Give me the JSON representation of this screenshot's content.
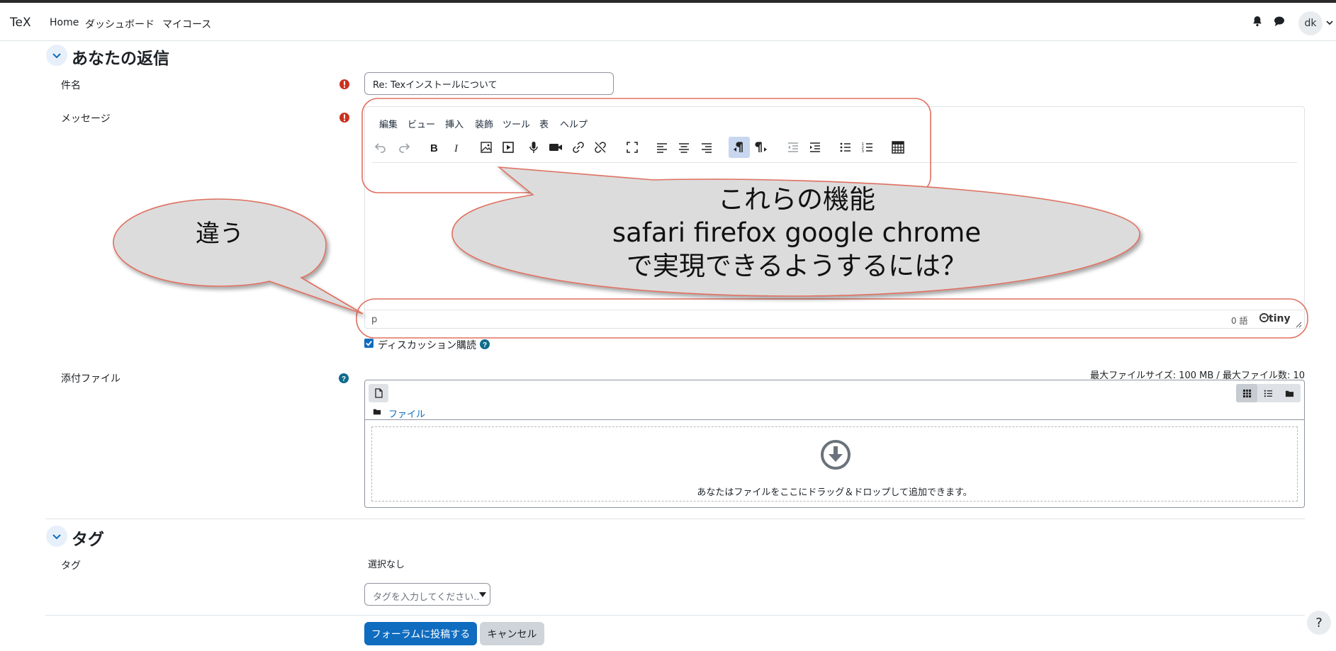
{
  "navbar": {
    "brand": "TeX",
    "links": [
      "Home",
      "ダッシュボード",
      "マイコース"
    ],
    "icons": [
      "bell-icon",
      "chat-icon"
    ],
    "avatar_initials": "dk"
  },
  "reply_section": {
    "title": "あなたの返信",
    "subject_label": "件名",
    "subject_value": "Re: Texインストールについて",
    "message_label": "メッセージ",
    "editor": {
      "menu": [
        "編集",
        "ビュー",
        "挿入",
        "装飾",
        "ツール",
        "表",
        "ヘルプ"
      ],
      "toolbar": [
        "undo-icon",
        "redo-icon",
        "bold-icon",
        "italic-icon",
        "image-icon",
        "media-icon",
        "microphone-icon",
        "video-icon",
        "link-icon",
        "unlink-icon",
        "fullscreen-icon",
        "align-left-icon",
        "align-center-icon",
        "align-right-icon",
        "ltr-icon",
        "rtl-icon",
        "outdent-icon",
        "indent-icon",
        "bullet-list-icon",
        "numbered-list-icon",
        "calculator-icon"
      ],
      "status_path": "p",
      "word_count": "0 語",
      "brand": "tiny"
    },
    "subscribe_label": "ディスカッション購読",
    "subscribe_checked": true,
    "attachments_label": "添付ファイル",
    "file_limits": "最大ファイルサイズ: 100 MB / 最大ファイル数: 10",
    "folder_label": "ファイル",
    "dropzone_text": "あなたはファイルをここにドラッグ＆ドロップして追加できます。"
  },
  "tags_section": {
    "title": "タグ",
    "tags_label": "タグ",
    "none_selected": "選択なし",
    "input_placeholder": "タグを入力してください..."
  },
  "buttons": {
    "submit": "フォーラムに投稿する",
    "cancel": "キャンセル"
  },
  "help_button": "?",
  "annotations": {
    "left_bubble": "違う",
    "right_bubble_lines": [
      "これらの機能",
      "safari firefox google chrome",
      "で実現できるようするには？"
    ],
    "stroke_color": "#e07060",
    "fill_color": "#dcdcdc"
  }
}
